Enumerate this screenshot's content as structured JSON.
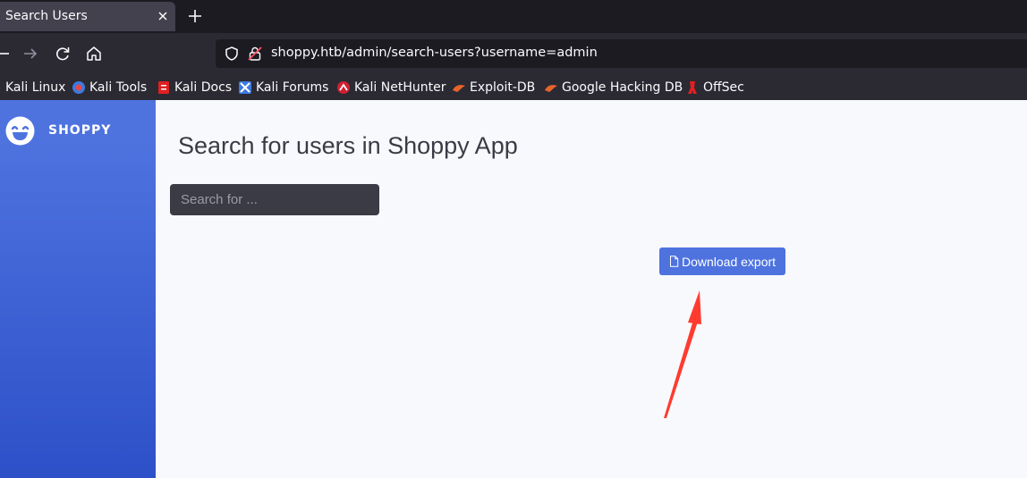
{
  "browser": {
    "tab": {
      "title": "Search Users"
    },
    "url": "shoppy.htb/admin/search-users?username=admin",
    "bookmarks": [
      {
        "label": "Kali Linux",
        "icon": "kali-linux-icon"
      },
      {
        "label": "Kali Tools",
        "icon": "kali-tools-icon"
      },
      {
        "label": "Kali Docs",
        "icon": "kali-docs-icon"
      },
      {
        "label": "Kali Forums",
        "icon": "kali-forums-icon"
      },
      {
        "label": "Kali NetHunter",
        "icon": "kali-nethunter-icon"
      },
      {
        "label": "Exploit-DB",
        "icon": "exploit-db-icon"
      },
      {
        "label": "Google Hacking DB",
        "icon": "google-hacking-db-icon"
      },
      {
        "label": "OffSec",
        "icon": "offsec-icon"
      }
    ]
  },
  "sidebar": {
    "brand": "SHOPPY",
    "brand_icon": "laughing-face-icon"
  },
  "main": {
    "title": "Search for users in Shoppy App",
    "search": {
      "placeholder": "Search for ...",
      "value": ""
    },
    "export_button": {
      "label": "Download export",
      "icon": "file-icon"
    }
  },
  "colors": {
    "primary": "#4e73df",
    "sidebar_end": "#2d50c8",
    "annotation_arrow": "#ff3b30",
    "page_bg": "#f8f9fc",
    "input_bg": "#3a3b45"
  }
}
